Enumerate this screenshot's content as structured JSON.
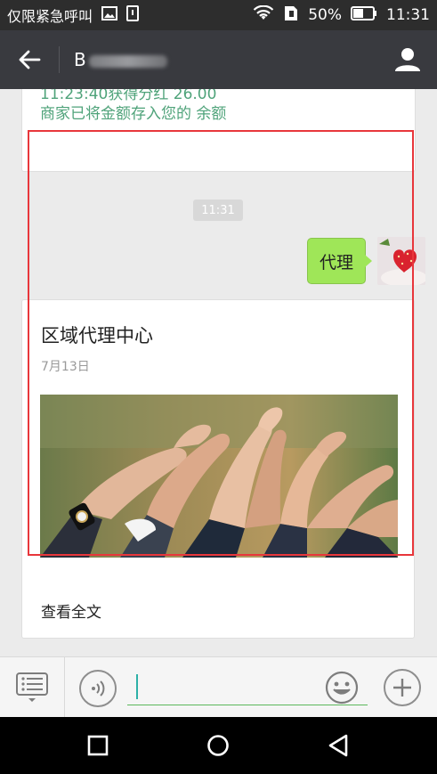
{
  "status_bar": {
    "carrier_text": "仅限紧急呼叫",
    "battery_percent": "50%",
    "time": "11:31",
    "icons": [
      "image-icon",
      "sim-icon",
      "wifi-icon",
      "sim-card-icon",
      "battery-icon"
    ]
  },
  "header": {
    "title_visible": "B",
    "title_obscured": true
  },
  "messages": {
    "previous_card": {
      "line1": "11:23:40获得分红 26.00",
      "line2": "商家已将金额存入您的 余额"
    },
    "timestamp": "11:31",
    "outgoing": {
      "text": "代理"
    },
    "article": {
      "title": "区域代理中心",
      "date": "7月13日",
      "read_more": "查看全文",
      "cover_subject": "hands-together-image"
    }
  },
  "input_bar": {
    "placeholder": "",
    "value": ""
  },
  "colors": {
    "status_bg": "#2d2d2d",
    "header_bg": "#393a3f",
    "chat_bg": "#ebebeb",
    "bubble_green": "#9fe658",
    "link_green": "#4fa37a",
    "highlight_red": "#e8363b"
  }
}
